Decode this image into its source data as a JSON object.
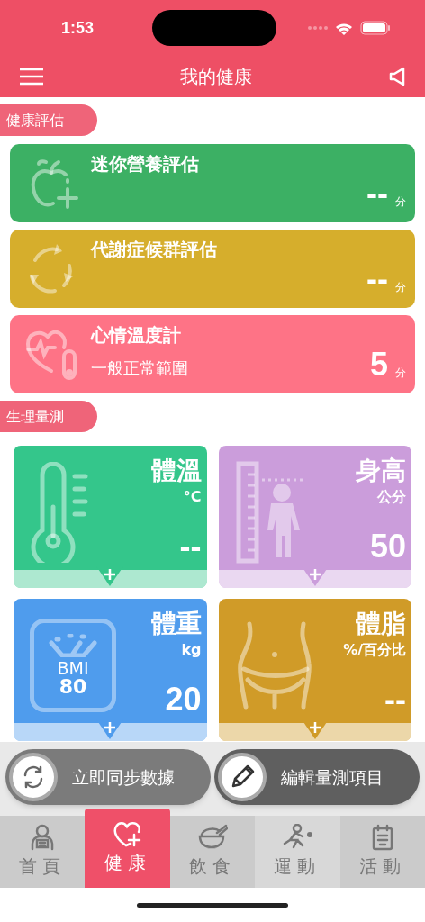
{
  "status_bar": {
    "time": "1:53"
  },
  "header": {
    "title": "我的健康"
  },
  "assessment": {
    "label": "健康評估",
    "cards": [
      {
        "kind": "nutrition",
        "title": "迷你營養評估",
        "score": "--",
        "unit": "分",
        "color": "#3cb064"
      },
      {
        "kind": "metabolic",
        "title": "代謝症候群評估",
        "score": "--",
        "unit": "分",
        "color": "#d6ae2c"
      },
      {
        "kind": "mood",
        "title": "心情溫度計",
        "note": "一般正常範圍",
        "score": "5",
        "unit": "分",
        "color": "#fe7386"
      }
    ]
  },
  "measurement": {
    "label": "生理量測",
    "tiles": [
      {
        "kind": "temperature",
        "title": "體溫",
        "unit": "°C",
        "value": "--",
        "color": "#34c68b"
      },
      {
        "kind": "height",
        "title": "身高",
        "unit": "公分",
        "value": "50",
        "color": "#cb9ddb"
      },
      {
        "kind": "weight",
        "title": "體重",
        "unit": "kg",
        "value": "20",
        "color": "#4f9ced",
        "icon_label": "BMI",
        "icon_value": "80"
      },
      {
        "kind": "fat",
        "title": "體脂",
        "unit": "%/百分比",
        "value": "--",
        "color": "#d09b28"
      }
    ]
  },
  "actions": [
    {
      "kind": "sync",
      "label": "立即同步數據"
    },
    {
      "kind": "edit",
      "label": "編輯量測項目"
    }
  ],
  "tabs": [
    {
      "kind": "home",
      "label": "首頁",
      "selected": false
    },
    {
      "kind": "health",
      "label": "健康",
      "selected": true
    },
    {
      "kind": "diet",
      "label": "飲食",
      "selected": false
    },
    {
      "kind": "exercise",
      "label": "運動",
      "selected": false
    },
    {
      "kind": "activity",
      "label": "活動",
      "selected": false
    }
  ]
}
